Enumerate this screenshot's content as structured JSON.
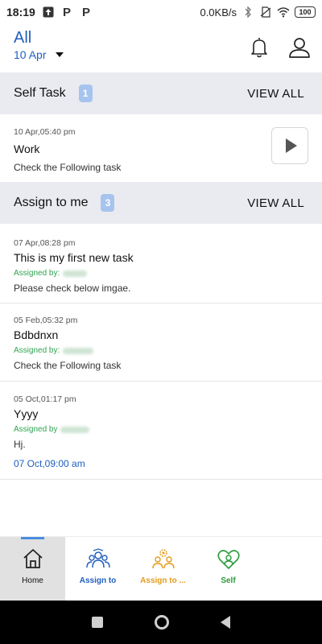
{
  "status_bar": {
    "time": "18:19",
    "left_icons": [
      "upload-icon",
      "parking-icon",
      "parking-icon"
    ],
    "speed": "0.0KB/s",
    "right_icons": [
      "bluetooth-icon",
      "no-sim-icon",
      "wifi-icon"
    ],
    "battery": "100"
  },
  "header": {
    "filter_title": "All",
    "date": "10 Apr",
    "icons": [
      "bell-icon",
      "user-icon"
    ]
  },
  "self_task": {
    "title": "Self Task",
    "count": "1",
    "view_all": "VIEW ALL",
    "items": [
      {
        "time": "10 Apr,05:40 pm",
        "name": "Work",
        "desc": "Check the Following task"
      }
    ]
  },
  "assign_to_me": {
    "title": "Assign to me",
    "count": "3",
    "view_all": "VIEW ALL",
    "items": [
      {
        "time": "07 Apr,08:28 pm",
        "name": "This is my first new task",
        "assigned": "Assigned by:",
        "desc": "Please check below imgae."
      },
      {
        "time": "05 Feb,05:32 pm",
        "name": "Bdbdnxn",
        "assigned": "Assigned by:",
        "desc": "Check the Following task"
      },
      {
        "time": "05 Oct,01:17 pm",
        "name": "Yyyy",
        "assigned": "Assigned by",
        "desc": "Hj.",
        "due": "07 Oct,09:00 am"
      }
    ]
  },
  "bottom_nav": {
    "items": [
      {
        "label": "Home",
        "icon": "home-icon"
      },
      {
        "label": "Assign to",
        "icon": "team-icon"
      },
      {
        "label": "Assign to ...",
        "icon": "gear-people-icon"
      },
      {
        "label": "Self",
        "icon": "person-heart-icon"
      }
    ],
    "colors": {
      "home": "#111111",
      "assign_to": "#1f5fbf",
      "assign_to_me": "#e39b1a",
      "self": "#2a9c3c",
      "active_indicator": "#4a8ee0"
    }
  }
}
